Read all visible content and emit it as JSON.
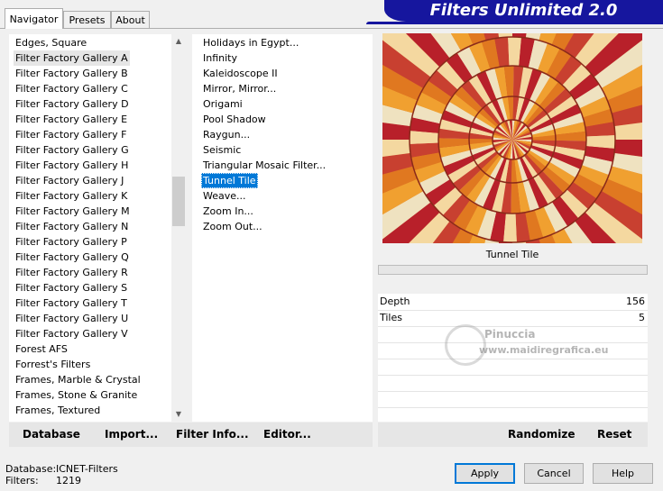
{
  "tabs": [
    "Navigator",
    "Presets",
    "About"
  ],
  "banner_title": "Filters Unlimited 2.0",
  "categories": [
    "Edges, Square",
    "Filter Factory Gallery A",
    "Filter Factory Gallery B",
    "Filter Factory Gallery C",
    "Filter Factory Gallery D",
    "Filter Factory Gallery E",
    "Filter Factory Gallery F",
    "Filter Factory Gallery G",
    "Filter Factory Gallery H",
    "Filter Factory Gallery J",
    "Filter Factory Gallery K",
    "Filter Factory Gallery M",
    "Filter Factory Gallery N",
    "Filter Factory Gallery P",
    "Filter Factory Gallery Q",
    "Filter Factory Gallery R",
    "Filter Factory Gallery S",
    "Filter Factory Gallery T",
    "Filter Factory Gallery U",
    "Filter Factory Gallery V",
    "Forest AFS",
    "Forrest's Filters",
    "Frames, Marble & Crystal",
    "Frames, Stone & Granite",
    "Frames, Textured"
  ],
  "selected_category": "Filter Factory Gallery A",
  "filters": [
    "Holidays in Egypt...",
    "Infinity",
    "Kaleidoscope II",
    "Mirror, Mirror...",
    "Origami",
    "Pool Shadow",
    "Raygun...",
    "Seismic",
    "Triangular Mosaic Filter...",
    "Tunnel Tile",
    "Weave...",
    "Zoom In...",
    "Zoom Out..."
  ],
  "selected_filter": "Tunnel Tile",
  "left_buttons": {
    "database": "Database",
    "import": "Import...",
    "filter_info": "Filter Info...",
    "editor": "Editor..."
  },
  "preview_label": "Tunnel Tile",
  "params": [
    {
      "name": "Depth",
      "value": "156"
    },
    {
      "name": "Tiles",
      "value": "5"
    }
  ],
  "watermark": {
    "line1": "Pinuccia",
    "line2": "www.maidiregrafica.eu"
  },
  "right_buttons": {
    "randomize": "Randomize",
    "reset": "Reset"
  },
  "status": {
    "database_label": "Database:",
    "database_value": "ICNET-Filters",
    "filters_label": "Filters:",
    "filters_value": "1219"
  },
  "dialog_buttons": {
    "apply": "Apply",
    "cancel": "Cancel",
    "help": "Help"
  },
  "icons": {
    "scroll_up": "chevron-up-icon",
    "scroll_down": "chevron-down-icon"
  },
  "colors": {
    "banner": "#16169e",
    "selection": "#0078d7",
    "preview_red": "#b8202a",
    "preview_orange": "#f0a030",
    "preview_cream": "#efe2c0"
  }
}
